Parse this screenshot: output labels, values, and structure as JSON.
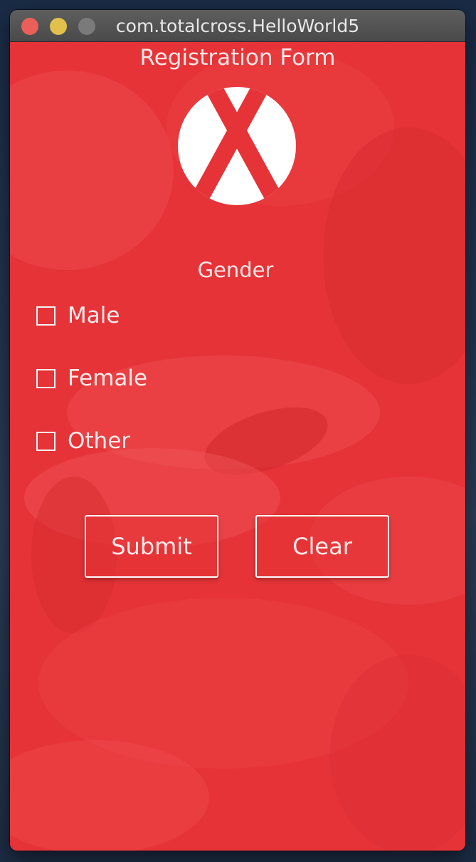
{
  "window": {
    "title": "com.totalcross.HelloWorld5",
    "traffic_lights": [
      "close",
      "minimize",
      "maximize"
    ]
  },
  "form": {
    "title": "Registration Form",
    "logo_icon": "totalcross-logo-icon",
    "gender_label": "Gender",
    "options": [
      {
        "label": "Male",
        "checked": false
      },
      {
        "label": "Female",
        "checked": false
      },
      {
        "label": "Other",
        "checked": false
      }
    ],
    "submit_label": "Submit",
    "clear_label": "Clear"
  },
  "colors": {
    "accent": "#e53337",
    "text": "#fce6e6"
  }
}
